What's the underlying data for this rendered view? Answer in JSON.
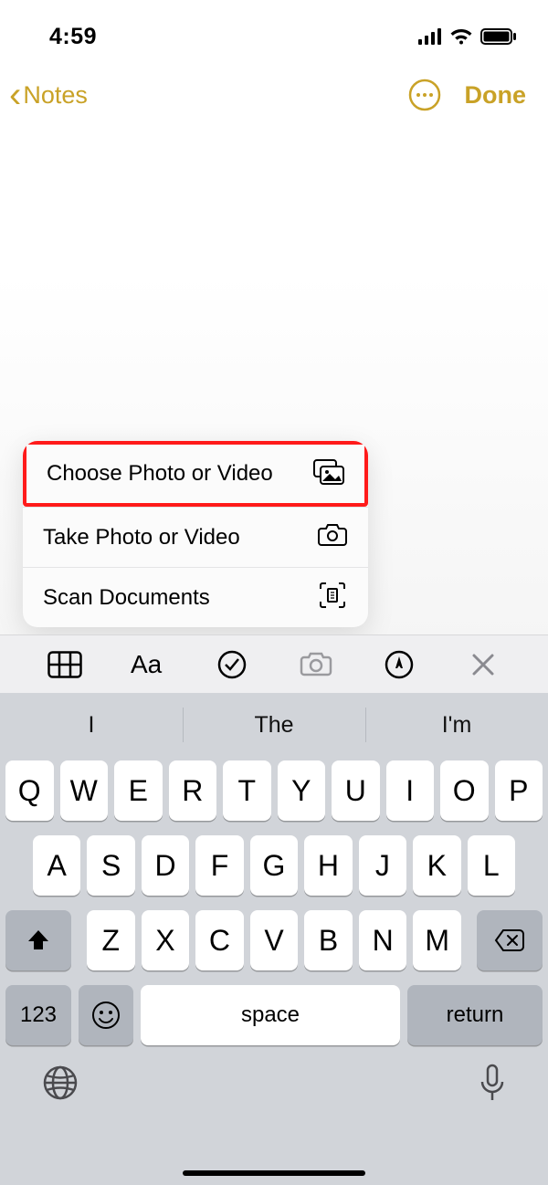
{
  "status": {
    "time": "4:59"
  },
  "nav": {
    "back_label": "Notes",
    "done_label": "Done"
  },
  "popup": {
    "items": [
      {
        "label": "Choose Photo or Video",
        "highlight": true
      },
      {
        "label": "Take Photo or Video"
      },
      {
        "label": "Scan Documents"
      }
    ]
  },
  "predictions": [
    "I",
    "The",
    "I'm"
  ],
  "keyboard": {
    "row1": [
      "Q",
      "W",
      "E",
      "R",
      "T",
      "Y",
      "U",
      "I",
      "O",
      "P"
    ],
    "row2": [
      "A",
      "S",
      "D",
      "F",
      "G",
      "H",
      "J",
      "K",
      "L"
    ],
    "row3": [
      "Z",
      "X",
      "C",
      "V",
      "B",
      "N",
      "M"
    ],
    "numbers_label": "123",
    "space_label": "space",
    "return_label": "return"
  }
}
